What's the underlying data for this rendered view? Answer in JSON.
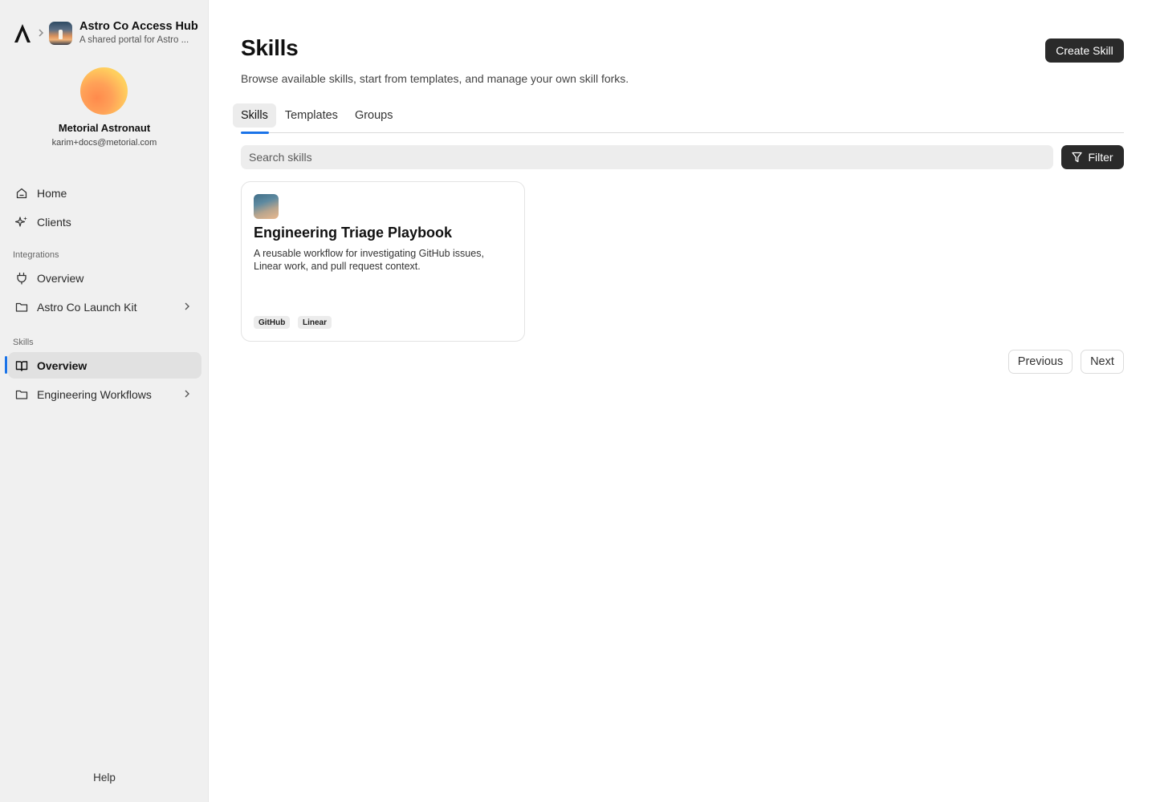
{
  "sidebar": {
    "portal": {
      "title": "Astro Co Access Hub",
      "subtitle": "A shared portal for Astro ..."
    },
    "user": {
      "name": "Metorial Astronaut",
      "email": "karim+docs@metorial.com"
    },
    "nav": {
      "home": "Home",
      "clients": "Clients"
    },
    "integrations": {
      "section_label": "Integrations",
      "overview": "Overview",
      "launch_kit": "Astro Co Launch Kit"
    },
    "skills": {
      "section_label": "Skills",
      "overview": "Overview",
      "workflows": "Engineering Workflows"
    },
    "help": "Help",
    "active_color": "#1a73e8"
  },
  "main": {
    "title": "Skills",
    "description": "Browse available skills, start from templates, and manage your own skill forks.",
    "create_button": "Create Skill",
    "tabs": [
      {
        "label": "Skills",
        "active": true
      },
      {
        "label": "Templates",
        "active": false
      },
      {
        "label": "Groups",
        "active": false
      }
    ],
    "search": {
      "placeholder": "Search skills",
      "value": ""
    },
    "filter_button": "Filter",
    "cards": [
      {
        "title": "Engineering Triage Playbook",
        "description": "A reusable workflow for investigating GitHub issues, Linear work, and pull request context.",
        "tags": [
          "GitHub",
          "Linear"
        ]
      }
    ],
    "pagination": {
      "previous": "Previous",
      "next": "Next"
    }
  },
  "icons": [
    "metorial-logo-icon",
    "chevron-right-icon",
    "home-icon",
    "sparkles-icon",
    "plug-icon",
    "folder-icon",
    "book-open-icon",
    "filter-icon"
  ]
}
